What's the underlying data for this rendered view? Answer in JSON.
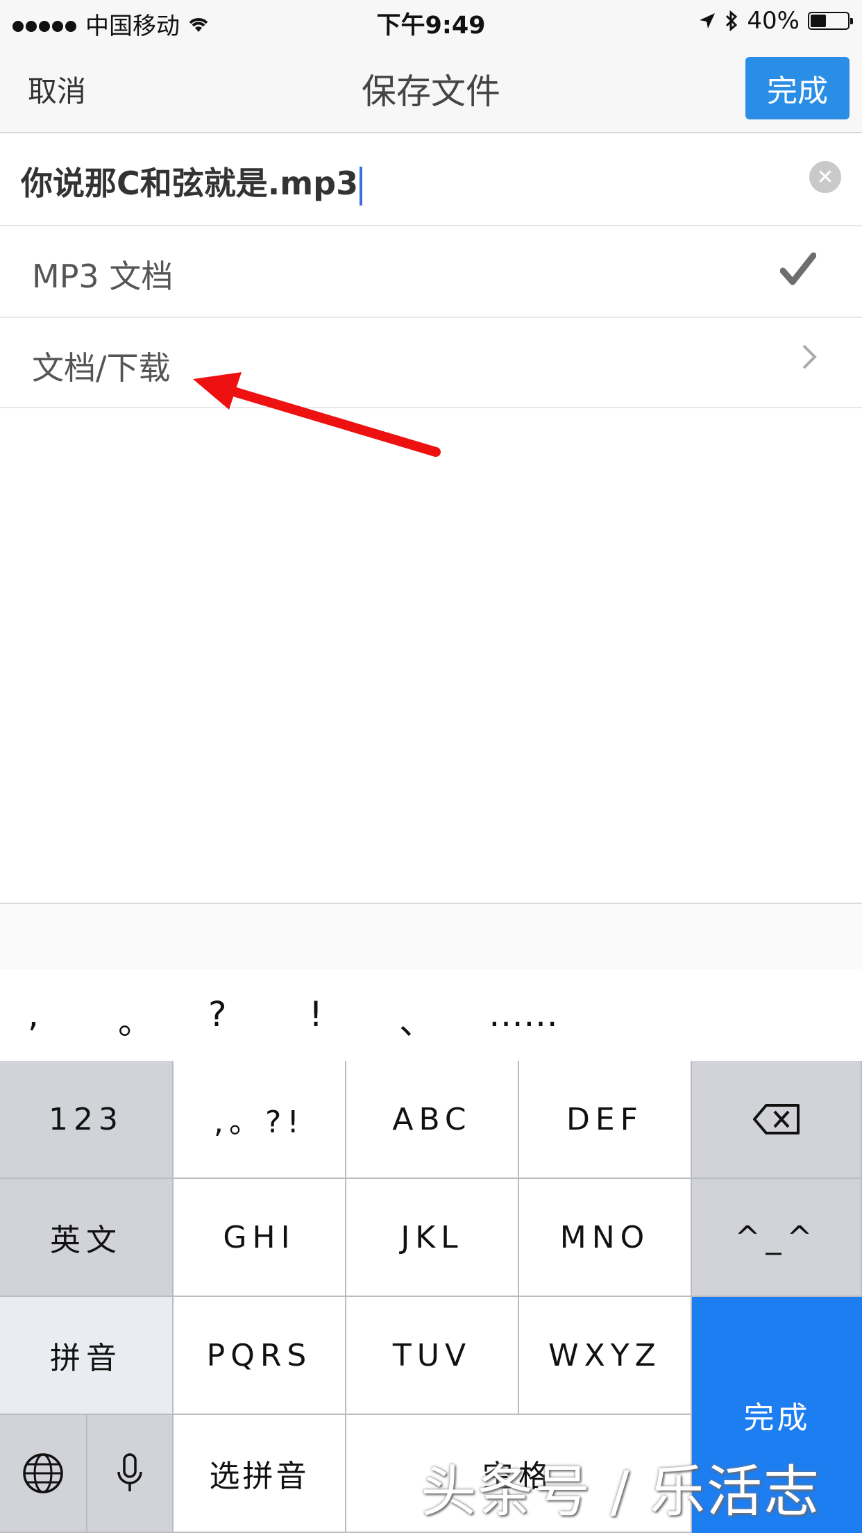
{
  "status_bar": {
    "carrier": "中国移动",
    "time": "下午9:49",
    "battery_percent": "40%",
    "battery_level": 0.4
  },
  "nav": {
    "cancel_label": "取消",
    "title": "保存文件",
    "done_label": "完成"
  },
  "file": {
    "name": "你说那C和弦就是.mp3",
    "type_label": "MP3 文档",
    "location_label": "文档/下载"
  },
  "punctuation": [
    ",",
    "。",
    "?",
    "!",
    "、",
    "……"
  ],
  "keyboard": {
    "row1": [
      "123",
      ",。?!",
      "ABC",
      "DEF"
    ],
    "row2": [
      "英文",
      "GHI",
      "JKL",
      "MNO",
      "^_^"
    ],
    "row3": [
      "拼音",
      "PQRS",
      "TUV",
      "WXYZ"
    ],
    "select_pinyin": "选拼音",
    "space_label": "空格",
    "done_label": "完成"
  },
  "watermark": "头条号 / 乐活志",
  "colors": {
    "accent": "#2a8de6",
    "keyboard_done": "#1d7ef2",
    "arrow": "#ee1111"
  },
  "icons": [
    "wifi-icon",
    "location-arrow-icon",
    "bluetooth-icon",
    "battery-icon",
    "clear-icon",
    "checkmark-icon",
    "chevron-right-icon",
    "backspace-icon",
    "globe-icon",
    "microphone-icon"
  ]
}
